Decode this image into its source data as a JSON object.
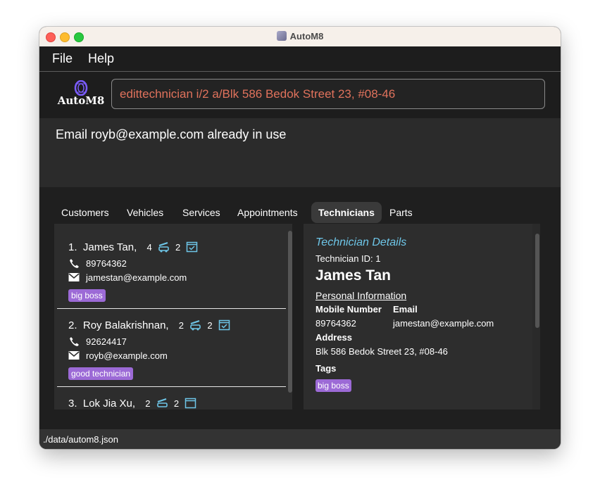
{
  "window": {
    "title": "AutoM8"
  },
  "menu": {
    "file": "File",
    "help": "Help"
  },
  "logo": {
    "text": "AutoM8"
  },
  "command": {
    "value": "edittechnician i/2 a/Blk 586 Bedok Street 23, #08-46"
  },
  "result": {
    "message": "Email royb@example.com already in use"
  },
  "tabs": [
    {
      "label": "Customers",
      "active": false
    },
    {
      "label": "Vehicles",
      "active": false
    },
    {
      "label": "Services",
      "active": false
    },
    {
      "label": "Appointments",
      "active": false
    },
    {
      "label": "Technicians",
      "active": true
    },
    {
      "label": "Parts",
      "active": false
    }
  ],
  "technicians": [
    {
      "index": "1.",
      "name": "James Tan,",
      "services": "4",
      "appointments": "2",
      "phone": "89764362",
      "email": "jamestan@example.com",
      "tag": "big boss"
    },
    {
      "index": "2.",
      "name": "Roy Balakrishnan,",
      "services": "2",
      "appointments": "2",
      "phone": "92624417",
      "email": "royb@example.com",
      "tag": "good technician"
    },
    {
      "index": "3.",
      "name": "Lok Jia Xu,",
      "services": "2",
      "appointments": "2"
    }
  ],
  "details": {
    "header": "Technician Details",
    "id_line": "Technician ID: 1",
    "name": "James Tan",
    "section": "Personal Information",
    "mobile_label": "Mobile Number",
    "mobile": "89764362",
    "email_label": "Email",
    "email": "jamestan@example.com",
    "address_label": "Address",
    "address": "Blk 586 Bedok Street 23, #08-46",
    "tags_label": "Tags",
    "tag": "big boss"
  },
  "status": {
    "path": "./data/autom8.json"
  },
  "colors": {
    "accent": "#6ec6e8",
    "tag": "#9c6ad6",
    "command_text": "#e0725c",
    "icon": "#6ec6e8"
  },
  "icons": {
    "service": "car-service-icon",
    "appointment": "calendar-check-icon",
    "phone": "phone-icon",
    "email": "envelope-icon"
  }
}
